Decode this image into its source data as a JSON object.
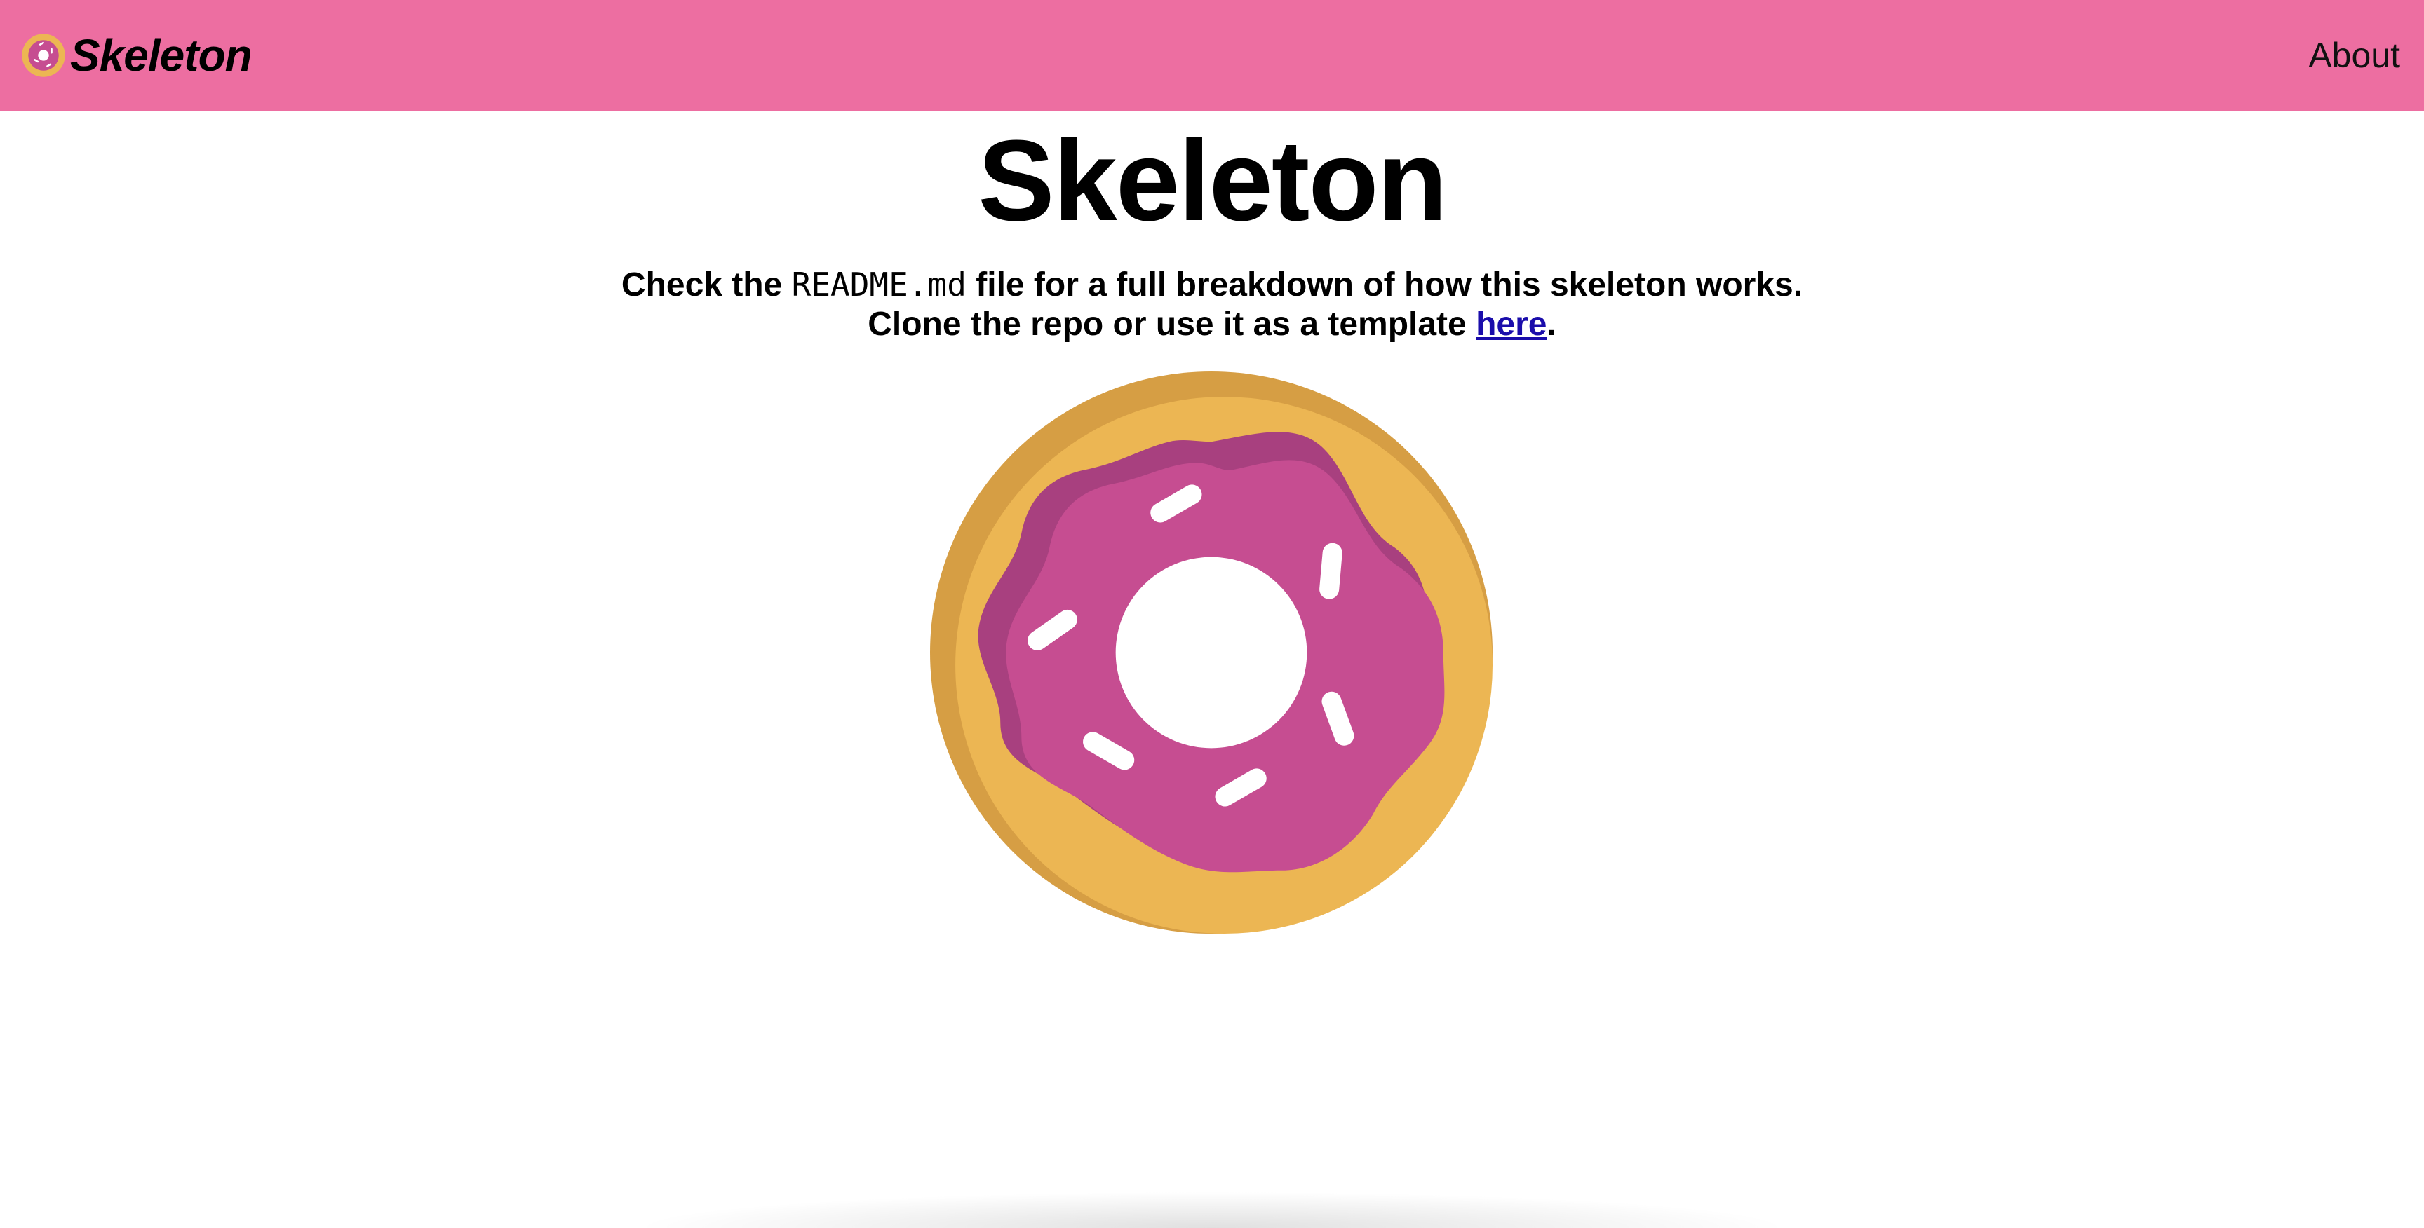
{
  "navbar": {
    "brand_text": "Skeleton",
    "brand_icon": "donut-icon",
    "about_label": "About",
    "background_color": "#ed6ea1"
  },
  "main": {
    "title": "Skeleton",
    "line1_prefix": "Check the ",
    "line1_code": "README.md",
    "line1_suffix": " file for a full breakdown of how this skeleton works.",
    "line2_prefix": "Clone the repo or use it as a template ",
    "line2_link": "here",
    "line2_suffix": ".",
    "illustration": "donut-illustration"
  },
  "colors": {
    "dough": "#ecb653",
    "dough_shade": "#d69e44",
    "icing": "#c64d91",
    "icing_shade": "#a8407f",
    "sprinkles": "#ffffff",
    "link": "#1a0dab"
  }
}
